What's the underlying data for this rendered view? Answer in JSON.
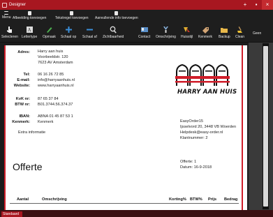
{
  "window": {
    "title": "Designer",
    "buttons": [
      "+",
      "▪",
      "×"
    ]
  },
  "menu_row": [
    {
      "label": "Menu",
      "icon": "menu-icon"
    },
    {
      "label": "Afbeelding toevoegen",
      "icon": "image-add-icon"
    },
    {
      "label": "Tekstregel toevoegen",
      "icon": "text-add-icon"
    },
    {
      "label": "Aanvullende info toevoegen",
      "icon": "info-add-icon"
    }
  ],
  "toolbar": [
    {
      "label": "Selecteren",
      "icon": "pointer-icon"
    },
    {
      "label": "Lettertype",
      "icon": "font-icon"
    },
    {
      "label": "Opmaak",
      "icon": "pencil-icon"
    },
    {
      "label": "Schaal op",
      "icon": "plus-icon"
    },
    {
      "label": "Schaal af",
      "icon": "minus-icon"
    },
    {
      "label": "Zichtbaarheid",
      "icon": "magnifier-icon"
    },
    {
      "label": "Contact",
      "icon": "contact-icon"
    },
    {
      "label": "Omschrijving",
      "icon": "description-icon"
    },
    {
      "label": "Huisstijl",
      "icon": "style-icon"
    },
    {
      "label": "Kenmerk",
      "icon": "tag-icon"
    },
    {
      "label": "Backup",
      "icon": "folder-icon"
    },
    {
      "label": "Clean",
      "icon": "broom-icon"
    }
  ],
  "geen_label": "Geen",
  "document": {
    "address_label": "Adres:",
    "address_lines": [
      "Harry aan huis",
      "Voorbeeldstr. 120",
      "7623 AV Amsterdam"
    ],
    "tel_label": "Tel:",
    "tel_value": "06 16 26 72 85",
    "email_label": "E-mail:",
    "email_value": "info@harryaanhuis.nl",
    "website_label": "Website:",
    "website_value": "www.harryaanhuis.nl",
    "kvk_label": "KvK nr:",
    "kvk_value": "87 65 37 84",
    "btw_label": "BTW nr:",
    "btw_value": "B01.3744.56.374.37",
    "iban_label": "IBAN:",
    "iban_value": "ABNA 01 45 87 53 1",
    "kenmerk_label": "Kenmerk:",
    "kenmerk_value": "Kenmerk",
    "extra_info": "Extra informatie",
    "logo_text": "HARRY AAN HUIS",
    "contact_lines": [
      "EasyOrder15",
      "Ijsselvord 20, 3448 VB Woerden",
      "Helpdesk@easy-order.nl",
      "Klantnummer: 2"
    ],
    "title": "Offerte",
    "offerte_lines": [
      "Offerte: 1",
      "Datum: 16-9-2018"
    ],
    "table_headers": [
      "Aantal",
      "Omschrijving",
      "Korting%",
      "BTW%",
      "Prijs",
      "Bedrag"
    ]
  },
  "status": {
    "tab_label": "Standaard"
  }
}
